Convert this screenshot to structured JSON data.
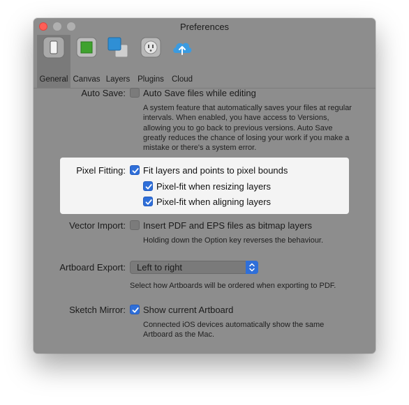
{
  "window": {
    "title": "Preferences"
  },
  "toolbar": {
    "tabs": [
      {
        "label": "General",
        "icon": "phone-icon",
        "active": true
      },
      {
        "label": "Canvas",
        "icon": "canvas-icon",
        "active": false
      },
      {
        "label": "Layers",
        "icon": "layers-icon",
        "active": false
      },
      {
        "label": "Plugins",
        "icon": "plug-icon",
        "active": false
      },
      {
        "label": "Cloud",
        "icon": "cloud-upload-icon",
        "active": false
      }
    ]
  },
  "auto_save": {
    "label": "Auto Save:",
    "option": "Auto Save files while editing",
    "checked": false,
    "description": "A system feature that automatically saves your files at regular intervals. When enabled, you have access to Versions, allowing you to go back to previous versions. Auto Save greatly reduces the chance of losing your work if you make a mistake or there's a system error."
  },
  "pixel_fitting": {
    "label": "Pixel Fitting:",
    "option": "Fit layers and points to pixel bounds",
    "checked": true,
    "sub_options": [
      {
        "label": "Pixel-fit when resizing layers",
        "checked": true
      },
      {
        "label": "Pixel-fit when aligning layers",
        "checked": true
      }
    ]
  },
  "vector_import": {
    "label": "Vector Import:",
    "option": "Insert PDF and EPS files as bitmap layers",
    "checked": false,
    "description": "Holding down the Option key reverses the behaviour."
  },
  "artboard_export": {
    "label": "Artboard Export:",
    "selected": "Left to right",
    "description": "Select how Artboards will be ordered when exporting to PDF."
  },
  "sketch_mirror": {
    "label": "Sketch Mirror:",
    "option": "Show current Artboard",
    "checked": true,
    "description": "Connected iOS devices automatically show the same Artboard as the Mac."
  },
  "colors": {
    "accent": "#2f6fd9",
    "window_bg": "#8d8d8d",
    "highlight_bg": "#f4f4f4",
    "close_button": "#ff5f57"
  }
}
